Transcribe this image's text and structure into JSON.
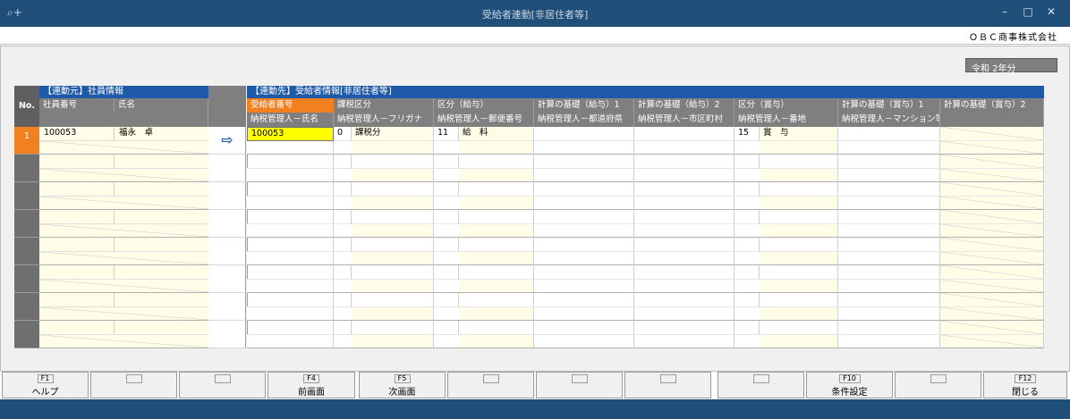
{
  "window": {
    "title": "受給者連動[非居住者等]",
    "minimize": "–",
    "maximize": "□",
    "close": "✕"
  },
  "company": "ＯＢＣ商事株式会社",
  "era_label": "令和 2年分",
  "left_grid": {
    "section_title": "【連動元】社員情報",
    "no_header": "No.",
    "columns": [
      "社員番号",
      "氏名"
    ],
    "rows": [
      {
        "no": "1",
        "employee_no": "100053",
        "name": "福永　卓"
      }
    ]
  },
  "arrow": "⇨",
  "right_grid": {
    "section_title": "【連動先】受給者情報[非居住者等]",
    "header_row1": [
      "受給者番号",
      "課税区分",
      "区分（給与）",
      "計算の基礎（給与）1",
      "計算の基礎（給与）2",
      "区分（賞与）",
      "計算の基礎（賞与）1",
      "計算の基礎（賞与）2"
    ],
    "header_row2": [
      "納税管理人－氏名",
      "納税管理人－フリガナ",
      "納税管理人－郵便番号",
      "納税管理人－都道府県",
      "納税管理人－市区町村",
      "納税管理人－番地",
      "納税管理人－マンション等",
      ""
    ],
    "rows": [
      {
        "recipient_no": "100053",
        "tax_code": "0",
        "tax_label": "課税分",
        "salary_code": "11",
        "salary_label": "給　料",
        "bonus_code": "15",
        "bonus_label": "賞　与"
      }
    ]
  },
  "function_keys": [
    {
      "code": "F1",
      "label": "ヘルプ"
    },
    {
      "code": "",
      "label": ""
    },
    {
      "code": "",
      "label": ""
    },
    {
      "code": "F4",
      "label": "前画面"
    },
    {
      "code": "F5",
      "label": "次画面"
    },
    {
      "code": "",
      "label": ""
    },
    {
      "code": "",
      "label": ""
    },
    {
      "code": "",
      "label": ""
    },
    {
      "code": "",
      "label": ""
    },
    {
      "code": "F10",
      "label": "条件設定"
    },
    {
      "code": "",
      "label": ""
    },
    {
      "code": "F12",
      "label": "閉じる"
    }
  ],
  "colors": {
    "titlebar": "#1f4e79",
    "header_blue": "#1e5aa8",
    "selected_orange": "#f08020",
    "input_yellow": "#fffde7",
    "active_yellow": "#ffff00"
  }
}
